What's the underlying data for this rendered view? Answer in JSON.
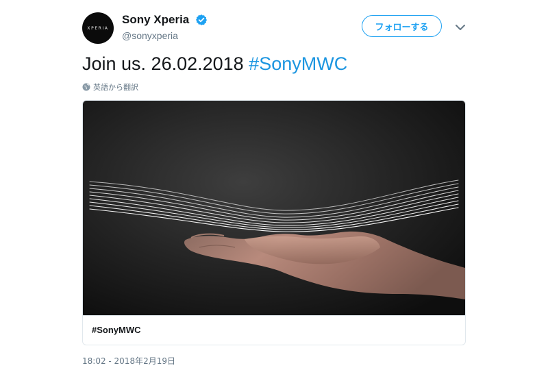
{
  "author": {
    "avatar_text": "XPERIA",
    "display_name": "Sony Xperia",
    "username": "@sonyxperia"
  },
  "actions": {
    "follow_label": "フォローする"
  },
  "tweet": {
    "text_prefix": "Join us. 26.02.2018 ",
    "hashtag": "#SonyMWC",
    "translate_label": "英語から翻訳"
  },
  "card": {
    "title": "#SonyMWC"
  },
  "meta": {
    "timestamp": "18:02 - 2018年2月19日"
  },
  "colors": {
    "accent": "#1da1f2",
    "link": "#1b95e0",
    "secondary_text": "#657786",
    "border": "#e1e8ed",
    "media_background": "#1e1e1e"
  },
  "icons": {
    "verified": "verified-badge-icon",
    "caret": "chevron-down-icon",
    "translate": "globe-icon"
  }
}
